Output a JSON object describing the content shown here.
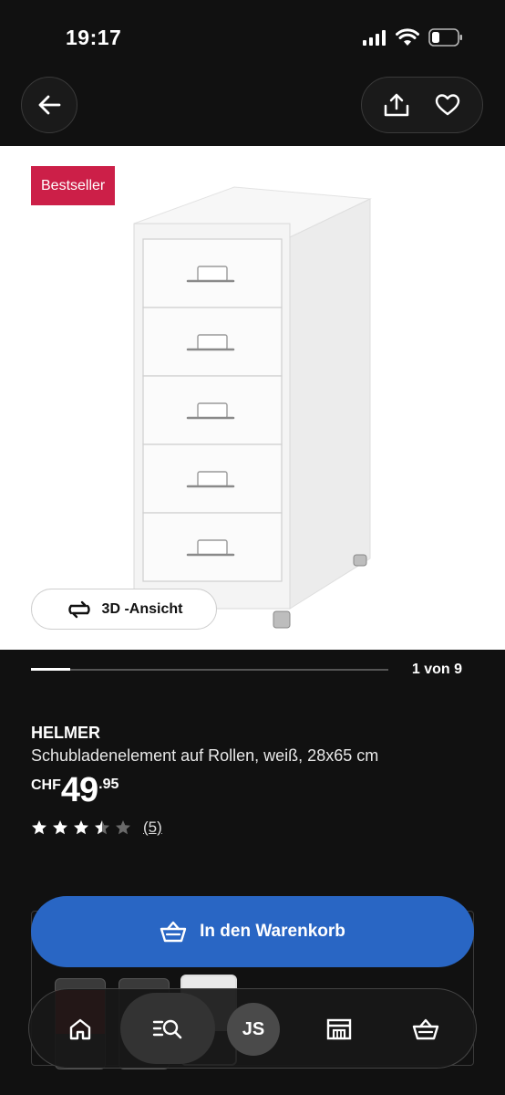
{
  "status_bar": {
    "time": "19:17"
  },
  "header": {
    "back_icon": "arrow-left-icon",
    "share_icon": "share-icon",
    "wishlist_icon": "heart-icon"
  },
  "gallery": {
    "badge": "Bestseller",
    "view_3d_label": "3D -Ansicht",
    "counter": "1 von 9",
    "progress": 0.11
  },
  "product": {
    "name": "HELMER",
    "description": "Schubladenelement auf Rollen, weiß, 28x65 cm",
    "price_currency": "CHF",
    "price_integer": "49",
    "price_decimal": ".95",
    "rating_value": 3.5,
    "rating_max": 5,
    "rating_count": "(5)"
  },
  "cart": {
    "label": "In den Warenkorb"
  },
  "bottom_nav": {
    "avatar_initials": "JS",
    "items": [
      "home-icon",
      "search-icon",
      "avatar",
      "store-icon",
      "basket-icon"
    ]
  },
  "colors": {
    "accent_blue": "#2966c4",
    "badge_red": "#cc1f48",
    "background": "#111111"
  }
}
